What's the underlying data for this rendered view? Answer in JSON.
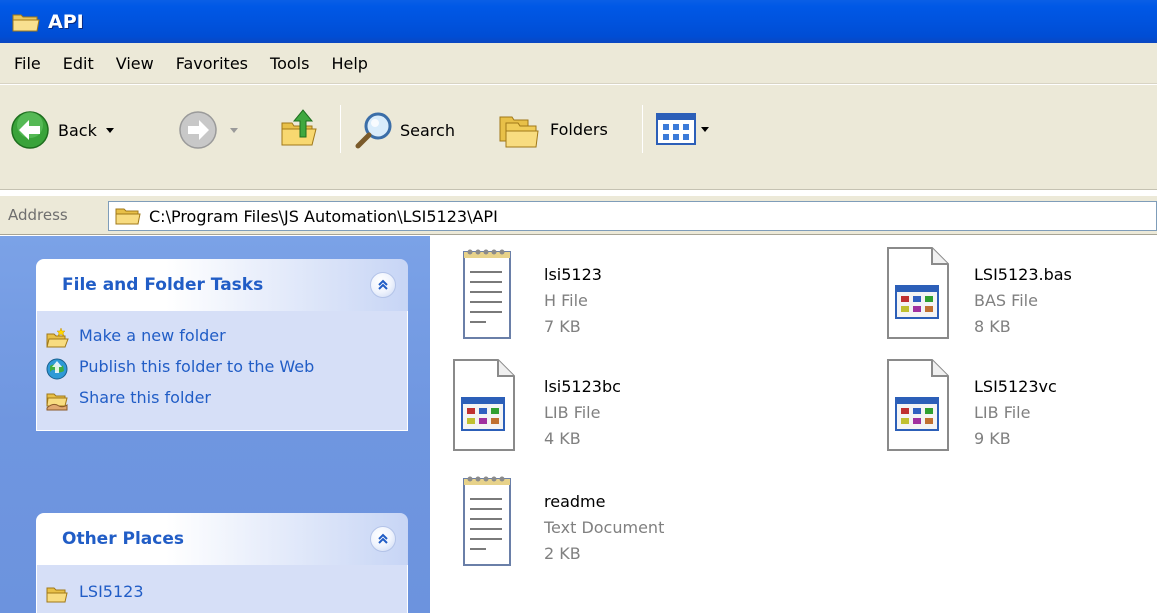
{
  "window": {
    "title": "API"
  },
  "menu": [
    "File",
    "Edit",
    "View",
    "Favorites",
    "Tools",
    "Help"
  ],
  "toolbar": {
    "back_label": "Back",
    "search_label": "Search",
    "folders_label": "Folders"
  },
  "address": {
    "label": "Address",
    "path": "C:\\Program Files\\JS Automation\\LSI5123\\API"
  },
  "tasks_panel": {
    "title": "File and Folder Tasks",
    "items": [
      {
        "label": "Make a new folder",
        "icon": "new-folder-icon"
      },
      {
        "label": "Publish this folder to the Web",
        "icon": "publish-web-icon"
      },
      {
        "label": "Share this folder",
        "icon": "share-folder-icon"
      }
    ]
  },
  "places_panel": {
    "title": "Other Places",
    "items": [
      {
        "label": "LSI5123",
        "icon": "folder-icon"
      }
    ]
  },
  "files": [
    {
      "name": "lsi5123",
      "type": "H File",
      "size": "7 KB",
      "icon": "text-document-icon"
    },
    {
      "name": "LSI5123.bas",
      "type": "BAS File",
      "size": "8 KB",
      "icon": "application-file-icon"
    },
    {
      "name": "lsi5123bc",
      "type": "LIB File",
      "size": "4 KB",
      "icon": "application-file-icon"
    },
    {
      "name": "LSI5123vc",
      "type": "LIB File",
      "size": "9 KB",
      "icon": "application-file-icon"
    },
    {
      "name": "readme",
      "type": "Text Document",
      "size": "2 KB",
      "icon": "text-document-icon"
    }
  ],
  "colors": {
    "titlebar": "#0054e3",
    "taskpane": "#6d95e0",
    "link": "#215dc6"
  }
}
